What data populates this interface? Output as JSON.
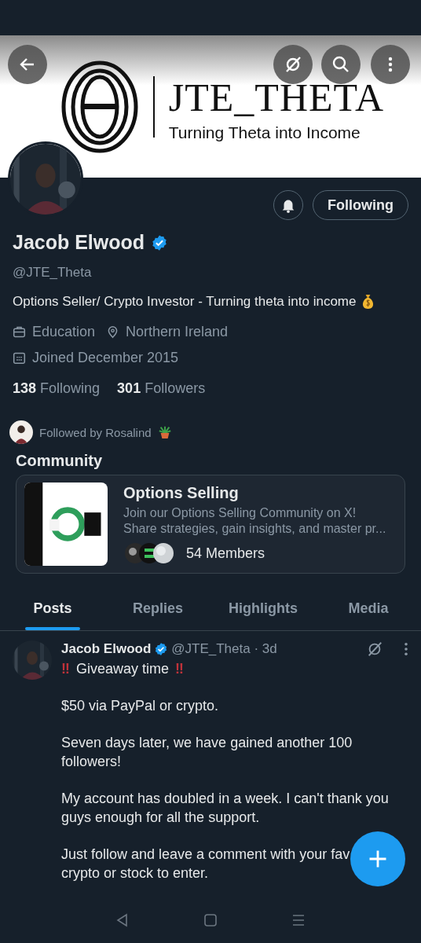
{
  "banner": {
    "title": "JTE_THETA",
    "tagline": "Turning Theta into Income"
  },
  "profile": {
    "name": "Jacob Elwood",
    "verified": true,
    "handle": "@JTE_Theta",
    "bio": "Options Seller/ Crypto Investor - Turning theta into income",
    "category": "Education",
    "location": "Northern Ireland",
    "joined": "Joined December 2015",
    "following_count": "138",
    "following_label": "Following",
    "followers_count": "301",
    "followers_label": "Followers",
    "followed_by": "Followed by Rosalind",
    "follow_button": "Following"
  },
  "community": {
    "heading": "Community",
    "name": "Options Selling",
    "description": [
      "Join our Options Selling Community on X!",
      "Share strategies, gain insights, and master pr..."
    ],
    "members": "54 Members"
  },
  "tabs": [
    {
      "label": "Posts",
      "selected": true
    },
    {
      "label": "Replies",
      "selected": false
    },
    {
      "label": "Highlights",
      "selected": false
    },
    {
      "label": "Media",
      "selected": false
    }
  ],
  "post": {
    "author": "Jacob Elwood",
    "verified": true,
    "handle": "@JTE_Theta · 3d",
    "headline": {
      "prefix": "‼",
      "text": "Giveaway time",
      "suffix": "‼"
    },
    "paragraphs": [
      [
        "$50 via PayPal or crypto."
      ],
      [
        "Seven days later, we have gained another 100",
        "followers!"
      ],
      [
        "My account has doubled in a week. I can't thank you",
        "guys enough for all the support."
      ],
      [
        "Just follow and leave a comment with your fav",
        "crypto or stock to enter."
      ]
    ]
  }
}
